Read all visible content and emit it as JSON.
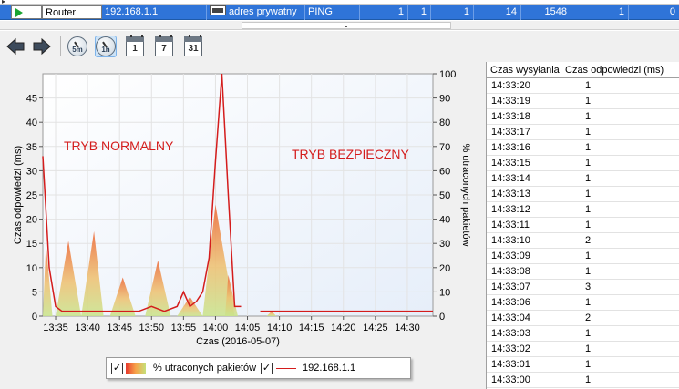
{
  "host_row": {
    "name": "Router",
    "ip": "192.168.1.1",
    "address_type": "adres prywatny",
    "protocol": "PING",
    "col1": "1",
    "col2": "1",
    "col3": "1",
    "col4": "14",
    "col5": "1548",
    "col6": "1",
    "col7": "0"
  },
  "toolbar": {
    "back_icon": "arrow-left-icon",
    "forward_icon": "arrow-right-icon",
    "range_5m": "5m",
    "range_1h": "1h",
    "range_1d": "1",
    "range_7d": "7",
    "range_31d": "31"
  },
  "chart": {
    "annotation_normal": "TRYB NORMALNY",
    "annotation_safe": "TRYB BEZPIECZNY",
    "legend_loss": "% utraconych pakietów",
    "legend_host": "192.168.1.1"
  },
  "chart_data": {
    "type": "line",
    "xlabel": "Czas (2016-05-07)",
    "ylabel": "Czas odpowiedzi (ms)",
    "y2label": "% utraconych pakietów",
    "ylim": [
      0,
      50
    ],
    "y2lim": [
      0,
      100
    ],
    "yticks": [
      0,
      5,
      10,
      15,
      20,
      25,
      30,
      35,
      40,
      45
    ],
    "y2ticks": [
      0,
      10,
      20,
      30,
      40,
      50,
      60,
      70,
      80,
      90,
      100
    ],
    "xlim": [
      "13:33",
      "14:34"
    ],
    "xticks": [
      "13:35",
      "13:40",
      "13:45",
      "13:50",
      "13:55",
      "14:00",
      "14:05",
      "14:10",
      "14:15",
      "14:20",
      "14:25",
      "14:30"
    ],
    "series": [
      {
        "name": "192.168.1.1",
        "color": "#d41c1c",
        "axis": "left",
        "segments": [
          [
            [
              "13:33",
              33
            ],
            [
              "13:34",
              10
            ],
            [
              "13:35",
              2
            ],
            [
              "13:36",
              1
            ],
            [
              "13:37",
              1
            ],
            [
              "13:38",
              1
            ],
            [
              "13:40",
              1
            ],
            [
              "13:42",
              1
            ],
            [
              "13:44",
              1
            ],
            [
              "13:46",
              1
            ],
            [
              "13:48",
              1
            ],
            [
              "13:50",
              2
            ],
            [
              "13:52",
              1
            ],
            [
              "13:54",
              2
            ],
            [
              "13:55",
              5
            ],
            [
              "13:56",
              2
            ],
            [
              "13:57",
              3
            ],
            [
              "13:58",
              5
            ],
            [
              "13:59",
              12
            ],
            [
              "14:00",
              32
            ],
            [
              "14:01",
              50
            ],
            [
              "14:02",
              25
            ],
            [
              "14:03",
              2
            ],
            [
              "14:04",
              2
            ]
          ],
          [
            [
              "14:07",
              1
            ],
            [
              "14:10",
              1
            ],
            [
              "14:15",
              1
            ],
            [
              "14:20",
              1
            ],
            [
              "14:25",
              1
            ],
            [
              "14:30",
              1
            ],
            [
              "14:34",
              1
            ]
          ]
        ]
      },
      {
        "name": "% utraconych pakietów",
        "type": "area",
        "axis": "right",
        "peaks": [
          {
            "start": "13:33",
            "peak": "13:33.5",
            "end": "13:34.5",
            "value": 30
          },
          {
            "start": "13:35",
            "peak": "13:37",
            "end": "13:39",
            "value": 31
          },
          {
            "start": "13:39",
            "peak": "13:41",
            "end": "13:42.5",
            "value": 35
          },
          {
            "start": "13:43.5",
            "peak": "13:45.5",
            "end": "13:47.5",
            "value": 16
          },
          {
            "start": "13:49",
            "peak": "13:51",
            "end": "13:53",
            "value": 23
          },
          {
            "start": "13:54",
            "peak": "13:56",
            "end": "13:58",
            "value": 8
          },
          {
            "start": "13:58",
            "peak": "14:00",
            "end": "14:03",
            "value": 46
          },
          {
            "start": "14:01.5",
            "peak": "14:02",
            "end": "14:03.5",
            "value": 17
          },
          {
            "start": "14:08",
            "peak": "14:08.8",
            "end": "14:09.5",
            "value": 2
          }
        ]
      }
    ],
    "grid": true
  },
  "table": {
    "headers": [
      "Czas wysyłania",
      "Czas odpowiedzi (ms)"
    ],
    "rows": [
      [
        "14:33:20",
        "1"
      ],
      [
        "14:33:19",
        "1"
      ],
      [
        "14:33:18",
        "1"
      ],
      [
        "14:33:17",
        "1"
      ],
      [
        "14:33:16",
        "1"
      ],
      [
        "14:33:15",
        "1"
      ],
      [
        "14:33:14",
        "1"
      ],
      [
        "14:33:13",
        "1"
      ],
      [
        "14:33:12",
        "1"
      ],
      [
        "14:33:11",
        "1"
      ],
      [
        "14:33:10",
        "2"
      ],
      [
        "14:33:09",
        "1"
      ],
      [
        "14:33:08",
        "1"
      ],
      [
        "14:33:07",
        "3"
      ],
      [
        "14:33:06",
        "1"
      ],
      [
        "14:33:04",
        "2"
      ],
      [
        "14:33:03",
        "1"
      ],
      [
        "14:33:02",
        "1"
      ],
      [
        "14:33:01",
        "1"
      ],
      [
        "14:33:00",
        "1"
      ]
    ]
  }
}
